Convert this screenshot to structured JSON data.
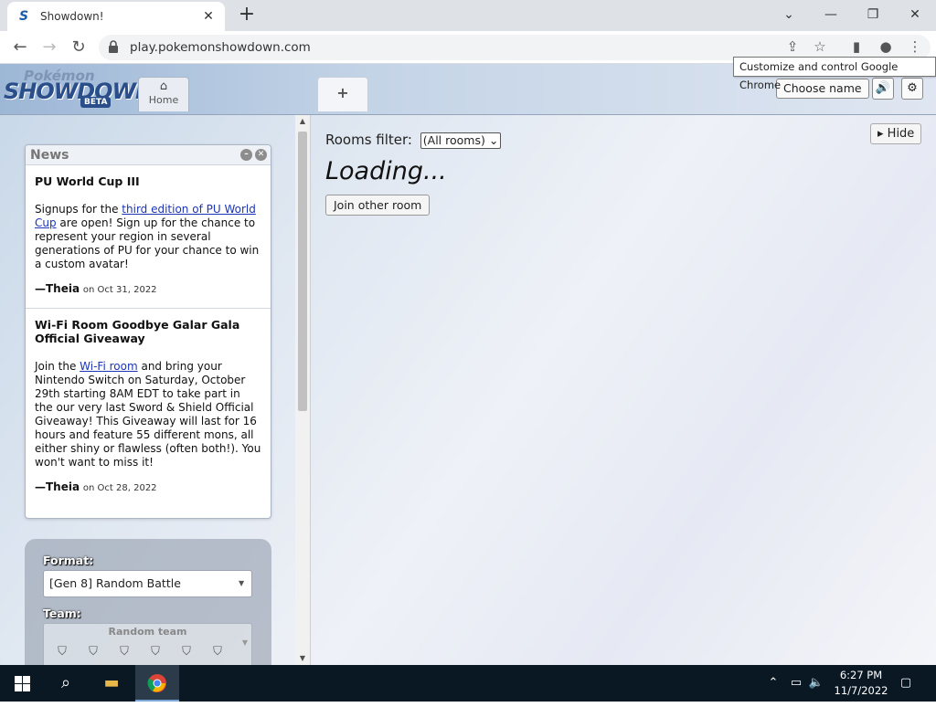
{
  "browser": {
    "tab_title": "Showdown!",
    "tab_favicon": "S",
    "url": "play.pokemonshowdown.com",
    "tooltip": "Customize and control Google Chrome"
  },
  "header": {
    "logo_top": "Pokémon",
    "logo_main": "SHOWDOWN!",
    "logo_beta": "BETA",
    "home_tab_label": "Home",
    "plus_tab_label": "+",
    "choose_name_label": "Choose name"
  },
  "news": {
    "title": "News",
    "items": [
      {
        "heading": "PU World Cup III",
        "text_before": "Signups for the ",
        "link": "third edition of PU World Cup",
        "text_after": " are open! Sign up for the chance to represent your region in several generations of PU for your chance to win a custom avatar!",
        "author": "—Theia",
        "date": "on Oct 31, 2022"
      },
      {
        "heading": "Wi-Fi Room Goodbye Galar Gala Official Giveaway",
        "text_before": "Join the ",
        "link": "Wi-Fi room",
        "text_after": " and bring your Nintendo Switch on Saturday, October 29th starting 8AM EDT to take part in the our very last Sword & Shield Official Giveaway! This Giveaway will last for 16 hours and feature 55 different mons, all either shiny or flawless (often both!). You won't want to miss it!",
        "author": "—Theia",
        "date": "on Oct 28, 2022"
      }
    ]
  },
  "battle_form": {
    "format_label": "Format:",
    "format_value": "[Gen 8] Random Battle",
    "team_label": "Team:",
    "team_value": "Random team"
  },
  "main": {
    "rooms_filter_label": "Rooms filter:",
    "rooms_filter_value": "(All rooms)",
    "loading_text": "Loading...",
    "join_other_room_label": "Join other room",
    "hide_label": "Hide"
  },
  "taskbar": {
    "time": "6:27 PM",
    "date": "11/7/2022"
  }
}
